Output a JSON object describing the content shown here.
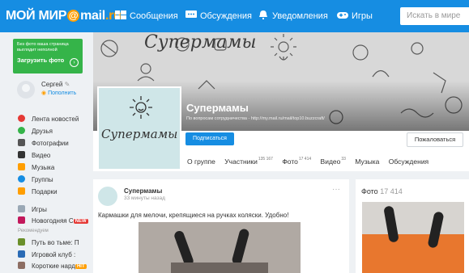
{
  "topbar": {
    "logo_main": "МОЙ МИР",
    "logo_at": "@",
    "logo_mail": "mail",
    "logo_ru": ".ru",
    "nav": [
      {
        "label": "Сообщения"
      },
      {
        "label": "Обсуждения"
      },
      {
        "label": "Уведомления"
      },
      {
        "label": "Игры"
      }
    ],
    "search_placeholder": "Искать в мире"
  },
  "promo": {
    "text": "Без фото ваша страница выглядит неполной",
    "button": "Загрузить фото"
  },
  "user": {
    "name": "Сергей",
    "pay": "Пополнить"
  },
  "menu": [
    {
      "label": "Лента новостей",
      "color": "#e53935"
    },
    {
      "label": "Друзья",
      "color": "#35b449"
    },
    {
      "label": "Фотографии",
      "color": "#555555"
    },
    {
      "label": "Видео",
      "color": "#333333"
    },
    {
      "label": "Музыка",
      "color": "#ff9e00"
    },
    {
      "label": "Группы",
      "color": "#168de2"
    },
    {
      "label": "Подарки",
      "color": "#ff9e00"
    }
  ],
  "games": [
    {
      "label": "Игры"
    },
    {
      "label": "Новогодняя С",
      "badge": "NEW"
    }
  ],
  "recommended_label": "Рекомендуем",
  "recommended": [
    {
      "label": "Путь во тьме: П"
    },
    {
      "label": "Игровой клуб :"
    },
    {
      "label": "Короткие нард",
      "badge": "HIT"
    }
  ],
  "group": {
    "cover_logo": "Супермамы",
    "avatar_logo": "Супермамы",
    "title": "Супермамы",
    "subtitle": "По вопросам сотрудничества - http://my.mail.ru/mail/top10.buzzcraft/",
    "subscribe": "Подписаться",
    "report": "Пожаловаться",
    "tabs": [
      {
        "label": "О группе",
        "count": ""
      },
      {
        "label": "Участники",
        "count": "135 167"
      },
      {
        "label": "Фото",
        "count": "17 414"
      },
      {
        "label": "Видео",
        "count": "33"
      },
      {
        "label": "Музыка",
        "count": ""
      },
      {
        "label": "Обсуждения",
        "count": ""
      }
    ]
  },
  "post": {
    "author": "Супермамы",
    "time": "33 минуты назад",
    "more": "···",
    "text": "Кармашки для мелочи, крепящиеся на ручках коляски. Удобно!"
  },
  "photos": {
    "title": "Фото",
    "count": "17 414"
  },
  "colors": {
    "brand_blue": "#168de2",
    "brand_orange": "#ff9e00",
    "promo_green": "#35b449",
    "badge_red": "#e53935"
  }
}
